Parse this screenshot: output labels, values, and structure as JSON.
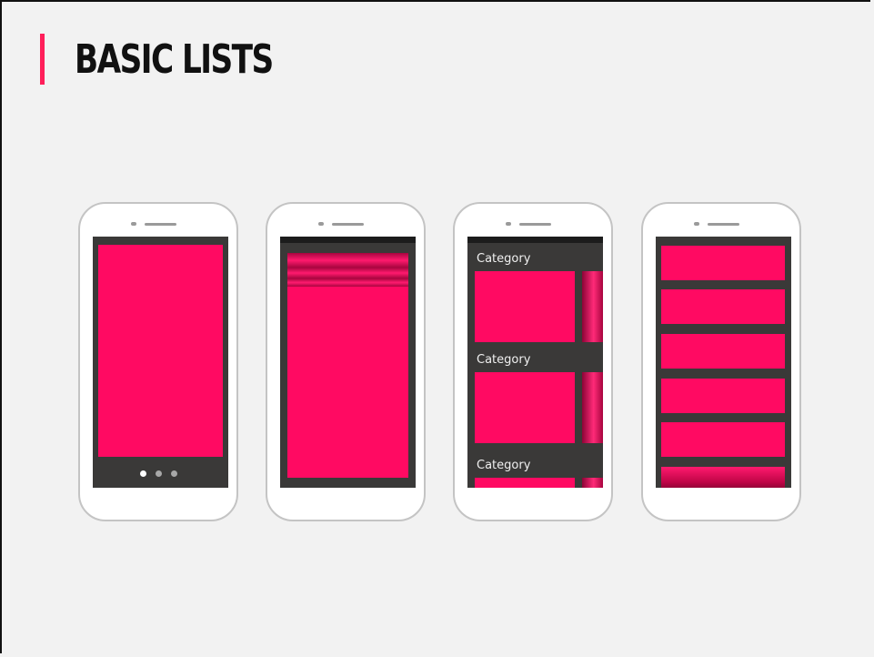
{
  "title": "BASIC LISTS",
  "accent_color": "#ff1f5a",
  "tile_color": "#ff0a62",
  "screen_color": "#3a3938",
  "phones": [
    {
      "id": "carousel",
      "pager_dots": 3,
      "active_dot": 1
    },
    {
      "id": "scrolling-list"
    },
    {
      "id": "category-rows",
      "category_labels": [
        "Category",
        "Category",
        "Category"
      ]
    },
    {
      "id": "stacked-cards",
      "cards": 6
    }
  ]
}
